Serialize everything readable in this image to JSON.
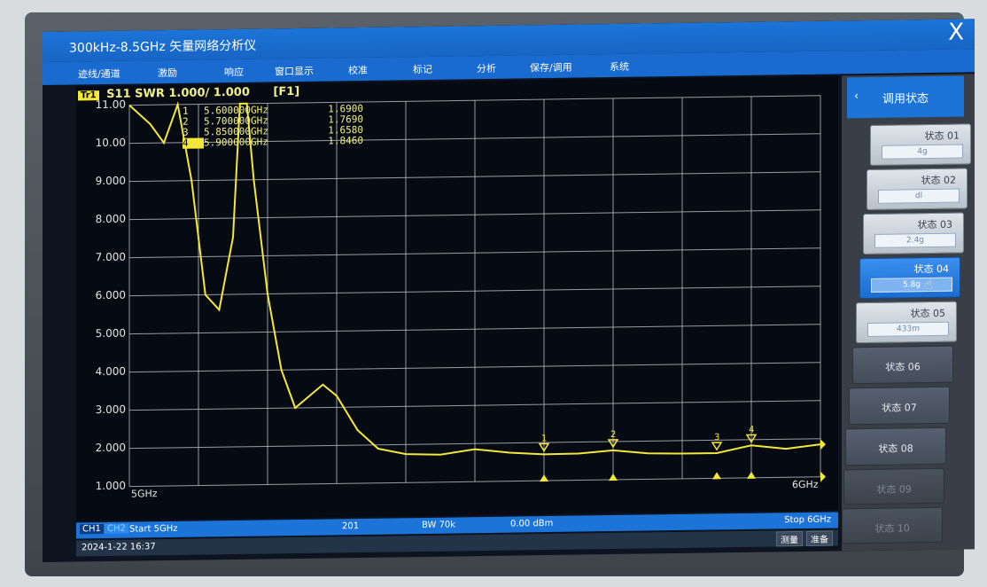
{
  "window": {
    "title": "300kHz-8.5GHz 矢量网络分析仪",
    "close_label": "X"
  },
  "menu": [
    "迹线/通道",
    "激励",
    "响应",
    "窗口显示",
    "校准",
    "标记",
    "分析",
    "保存/调用",
    "系统"
  ],
  "trace": {
    "chip": "Tr1",
    "label": "S11 SWR 1.000/ 1.000",
    "func": "[F1]"
  },
  "y_axis": [
    "11.00",
    "10.00",
    "9.000",
    "8.000",
    "7.000",
    "6.000",
    "5.000",
    "4.000",
    "3.000",
    "2.000",
    "1.000"
  ],
  "x_axis": {
    "start": "5GHz",
    "stop": "6GHz"
  },
  "markers": [
    {
      "id": "1",
      "freq": "5.600000GHz",
      "value": "1.6900"
    },
    {
      "id": "2",
      "freq": "5.700000GHz",
      "value": "1.7690"
    },
    {
      "id": "3",
      "freq": "5.850000GHz",
      "value": "1.6580"
    },
    {
      "id": "4",
      "freq": "5.900000GHz",
      "value": "1.8460"
    }
  ],
  "status": {
    "ch1": "CH1",
    "ch2": "CH2",
    "start": "Start 5GHz",
    "points": "201",
    "bw": "BW 70k",
    "power": "0.00 dBm",
    "stop": "Stop 6GHz",
    "datetime": "2024-1-22 16:37",
    "measure_btn": "测量",
    "ready_btn": "准备"
  },
  "panel": {
    "header": "调用状态",
    "chevron": "‹",
    "states": [
      {
        "label": "状态 01",
        "value": "4g"
      },
      {
        "label": "状态 02",
        "value": "dl"
      },
      {
        "label": "状态 03",
        "value": "2.4g"
      },
      {
        "label": "状态 04",
        "value": "5.8g"
      },
      {
        "label": "状态 05",
        "value": "433m"
      },
      {
        "label": "状态 06"
      },
      {
        "label": "状态 07"
      },
      {
        "label": "状态 08"
      },
      {
        "label": "状态 09"
      },
      {
        "label": "状态 10"
      }
    ]
  },
  "colors": {
    "trace": "#f3e83a",
    "grid": "#c9ccd1",
    "accent": "#1c74d8"
  },
  "chart_data": {
    "type": "line",
    "xlim": [
      5.0,
      6.0
    ],
    "ylim": [
      1.0,
      11.0
    ],
    "x": [
      5.0,
      5.03,
      5.05,
      5.07,
      5.09,
      5.11,
      5.13,
      5.15,
      5.16,
      5.17,
      5.18,
      5.2,
      5.22,
      5.24,
      5.26,
      5.28,
      5.3,
      5.33,
      5.36,
      5.4,
      5.45,
      5.5,
      5.55,
      5.6,
      5.65,
      5.7,
      5.75,
      5.8,
      5.85,
      5.9,
      5.95,
      6.0
    ],
    "y": [
      11.0,
      10.5,
      10.0,
      11.0,
      9.0,
      6.0,
      5.6,
      7.5,
      11.0,
      11.0,
      9.0,
      6.0,
      4.0,
      3.0,
      3.3,
      3.6,
      3.3,
      2.4,
      1.9,
      1.75,
      1.72,
      1.85,
      1.75,
      1.69,
      1.7,
      1.77,
      1.68,
      1.66,
      1.66,
      1.85,
      1.75,
      1.85
    ],
    "markers": [
      {
        "id": "1",
        "x": 5.6,
        "y": 1.69
      },
      {
        "id": "2",
        "x": 5.7,
        "y": 1.769
      },
      {
        "id": "3",
        "x": 5.85,
        "y": 1.658
      },
      {
        "id": "4",
        "x": 5.9,
        "y": 1.846
      }
    ]
  }
}
